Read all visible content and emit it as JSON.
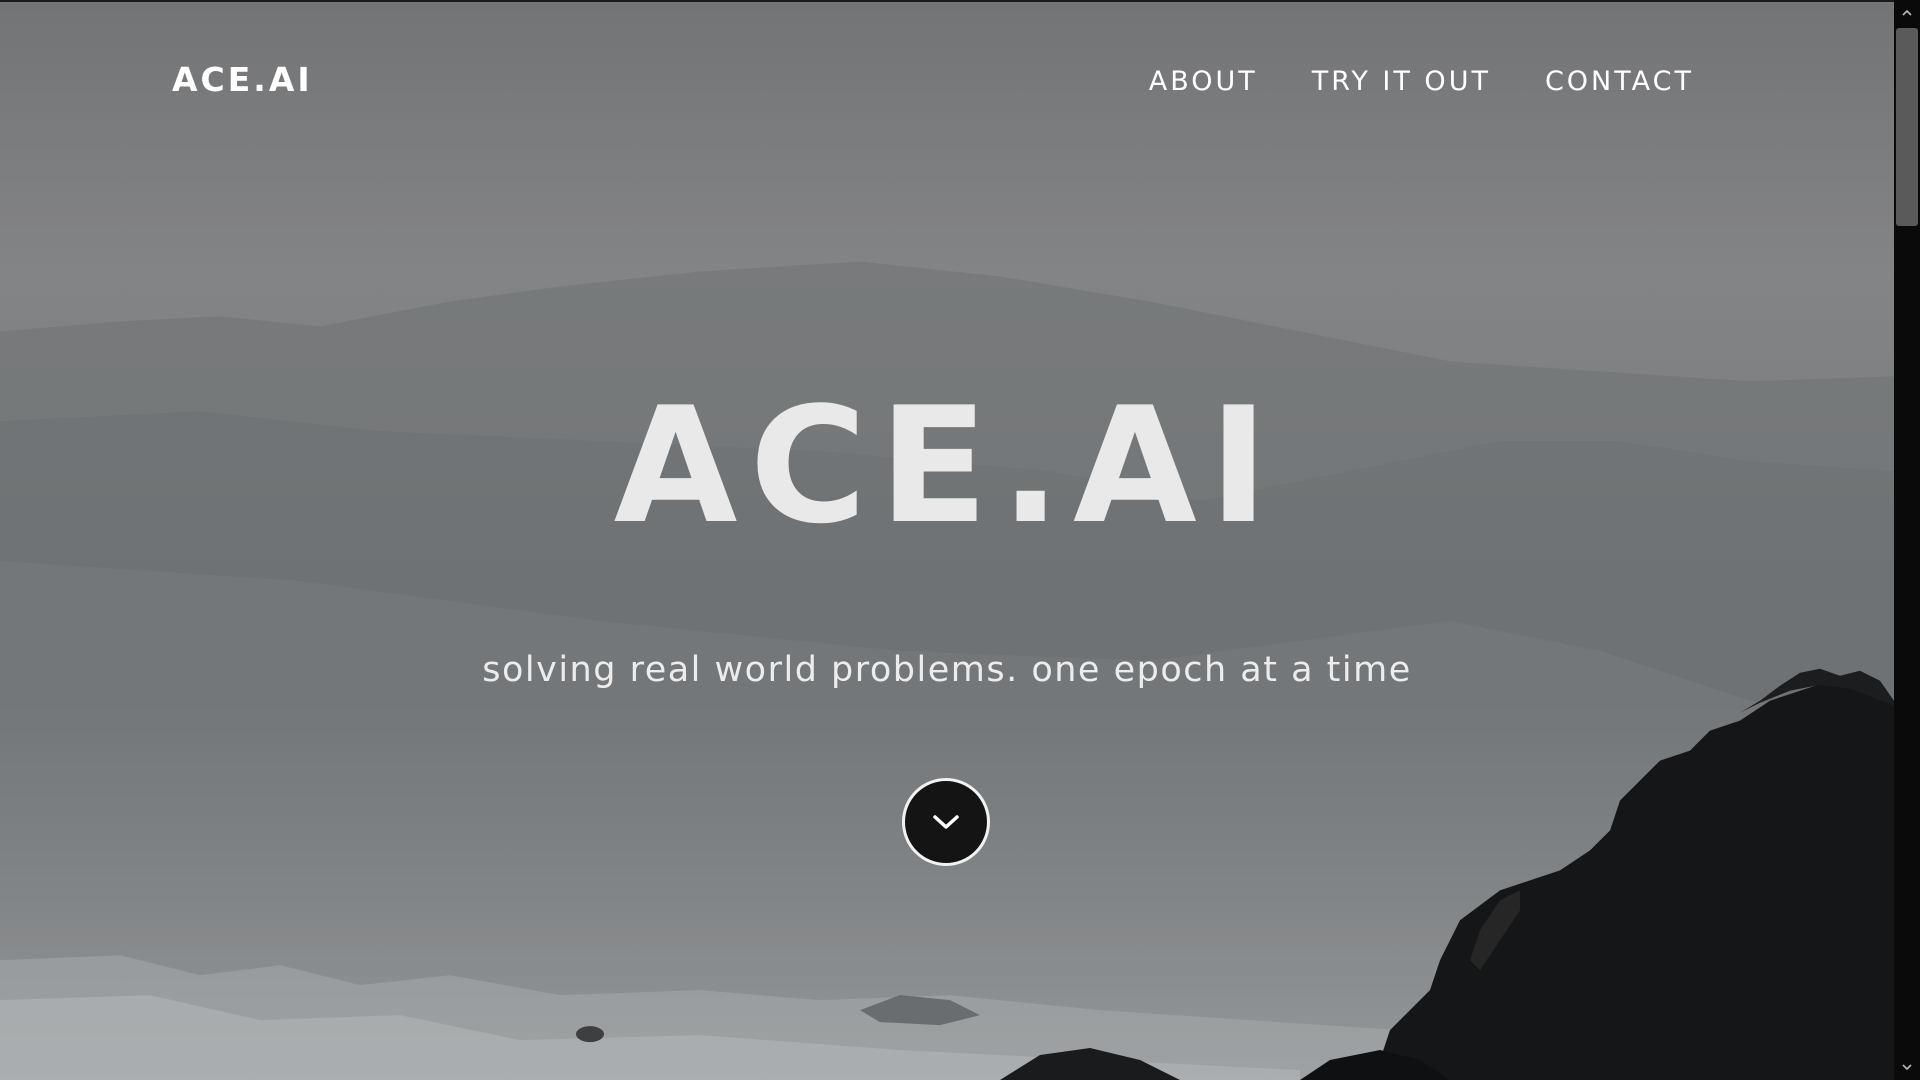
{
  "header": {
    "logo": "ACE.AI",
    "nav": [
      {
        "label": "ABOUT"
      },
      {
        "label": "TRY IT OUT"
      },
      {
        "label": "CONTACT"
      }
    ]
  },
  "hero": {
    "title": "ACE.AI",
    "subtitle": "solving real world problems. one epoch at a time",
    "scroll_icon": "chevron-down-icon"
  },
  "theme": {
    "text_color": "#ffffff",
    "button_bg": "#141414"
  }
}
